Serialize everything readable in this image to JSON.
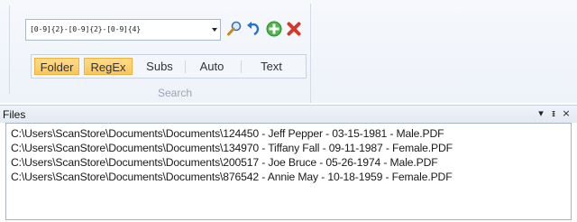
{
  "search": {
    "pattern_value": "[0-9]{2}-[0-9]{2}-[0-9]{4}",
    "tools": [
      "search-icon",
      "undo-icon",
      "add-icon",
      "delete-icon"
    ],
    "modes": [
      {
        "label": "Folder",
        "active": true
      },
      {
        "label": "RegEx",
        "active": true
      },
      {
        "label": "Subs",
        "active": false
      },
      {
        "label": "Auto",
        "active": false
      },
      {
        "label": "Text",
        "active": false
      }
    ],
    "group_label": "Search"
  },
  "files_panel": {
    "title": "Files",
    "buttons": {
      "dropdown": "▾",
      "pin": "ᵻ",
      "close": "×"
    },
    "items": [
      "C:\\Users\\ScanStore\\Documents\\Documents\\124450 - Jeff Pepper - 03-15-1981 - Male.PDF",
      "C:\\Users\\ScanStore\\Documents\\Documents\\134970 - Tiffany Fall - 09-11-1987 - Female.PDF",
      "C:\\Users\\ScanStore\\Documents\\Documents\\200517 - Joe Bruce - 05-26-1974 - Male.PDF",
      "C:\\Users\\ScanStore\\Documents\\Documents\\876542 - Annie May - 10-18-1959 - Female.PDF"
    ]
  },
  "colors": {
    "active_mode": "#fbc65a",
    "search_icon": "#3b6fb0",
    "undo_icon": "#2a6fd1",
    "add_icon": "#3aa53a",
    "delete_icon": "#d43a2a"
  }
}
